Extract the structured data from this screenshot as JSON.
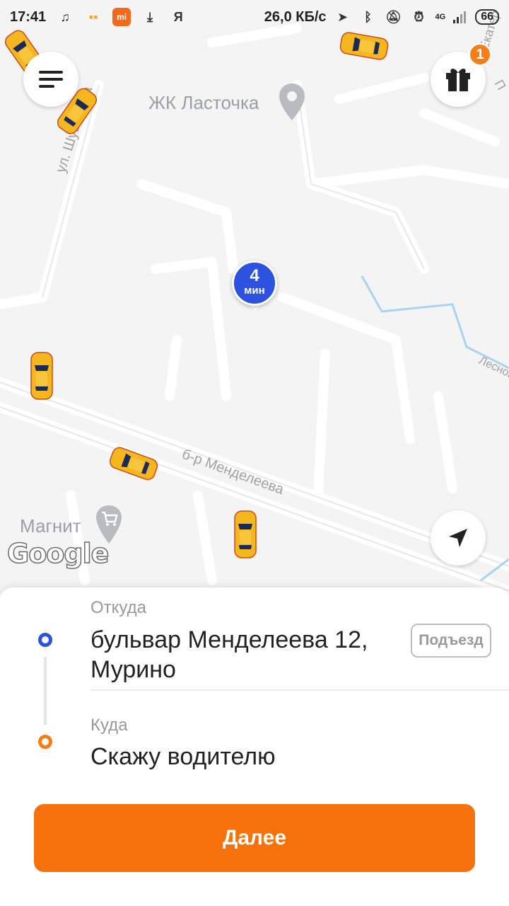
{
  "status_bar": {
    "time": "17:41",
    "network_speed": "26,0 КБ/с",
    "battery": "66",
    "network_type": "4G",
    "app_icon_text": "mi",
    "yandex_icon": "Я"
  },
  "map": {
    "pois": [
      {
        "label": "ЖК Ласточка",
        "icon": "place-pin-icon"
      },
      {
        "label": "Магнит",
        "icon": "shopping-cart-icon"
      }
    ],
    "streets": {
      "shuvalova": "ул. Шувалова",
      "mendeleeva": "б-р Менделеева",
      "lesnaya": "Лесной",
      "right_edge": "Екатер",
      "right_edge_2": "П"
    },
    "eta": {
      "value": "4",
      "unit": "мин"
    },
    "google_logo": "Google",
    "gift_badge_count": "1"
  },
  "route": {
    "from_caption": "Откуда",
    "from_line1": "бульвар Менделеева 12,",
    "from_line2": "Мурино",
    "entrance_label": "Подъезд",
    "to_caption": "Куда",
    "to_value": "Скажу водителю"
  },
  "actions": {
    "next_label": "Далее"
  },
  "colors": {
    "accent": "#f8720c",
    "eta_blue": "#2d52e0",
    "map_bg": "#f4f4f4"
  }
}
